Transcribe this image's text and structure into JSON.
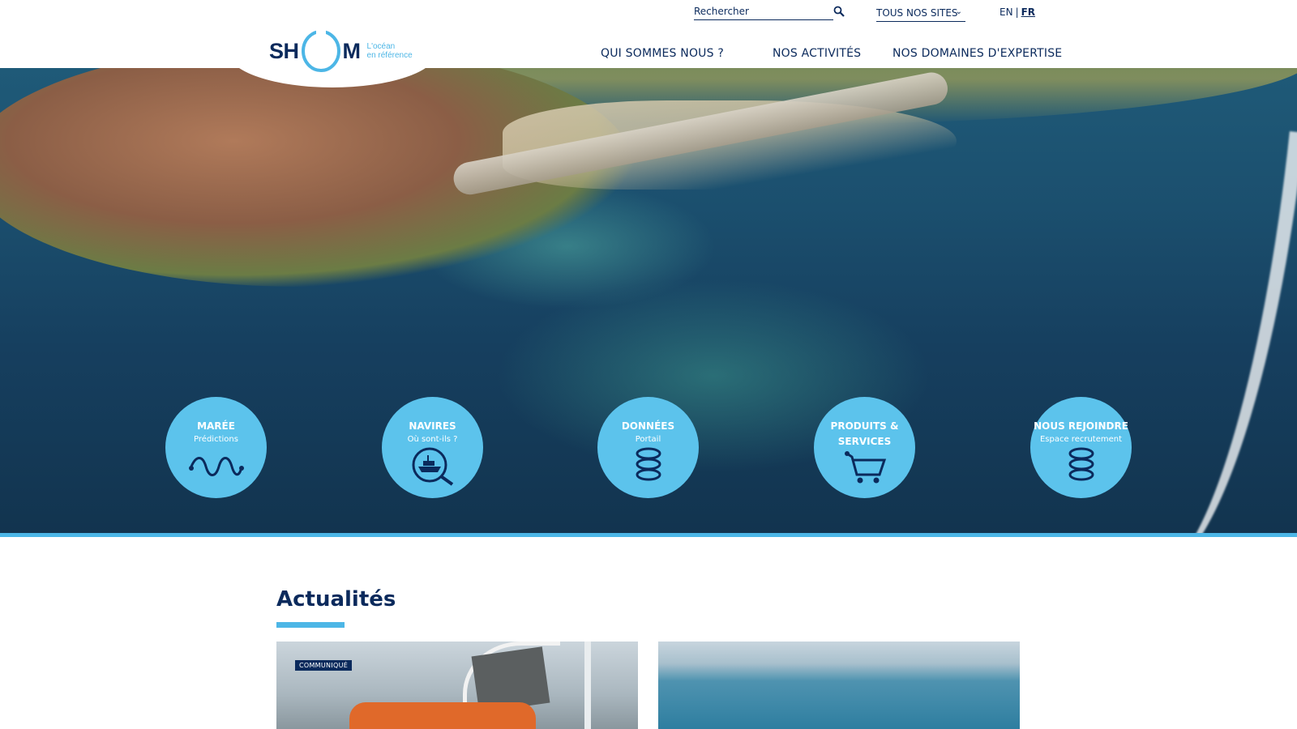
{
  "header": {
    "logo": {
      "word_left": "SH",
      "word_right": "M",
      "tagline_line1": "L'océan",
      "tagline_line2": "en référence"
    },
    "search": {
      "placeholder": "Rechercher"
    },
    "sites_dropdown": {
      "label": "TOUS NOS SITES"
    },
    "languages": {
      "en": "EN",
      "separator": "|",
      "fr": "FR",
      "active": "FR"
    },
    "nav": [
      {
        "label": "QUI SOMMES NOUS ?"
      },
      {
        "label": "NOS ACTIVITÉS"
      },
      {
        "label": "NOS DOMAINES D'EXPERTISE"
      }
    ]
  },
  "hero": {
    "quick_links": [
      {
        "title": "MARÉE",
        "subtitle": "Prédictions",
        "icon": "tide-wave-icon"
      },
      {
        "title": "NAVIRES",
        "subtitle": "Où sont-ils ?",
        "icon": "ship-search-icon"
      },
      {
        "title": "DONNÉES",
        "subtitle": "Portail",
        "icon": "data-layers-icon"
      },
      {
        "title": "PRODUITS &",
        "title_line2": "SERVICES",
        "subtitle": "",
        "icon": "cart-icon"
      },
      {
        "title": "NOUS REJOINDRE",
        "subtitle": "Espace recrutement",
        "icon": "data-layers-icon"
      }
    ]
  },
  "news": {
    "title": "Actualités",
    "cards": [
      {
        "badge": "COMMUNIQUÉ"
      },
      {
        "badge": ""
      }
    ]
  },
  "colors": {
    "navy": "#0b2a5c",
    "accent": "#4cb6e6",
    "circle": "#5cc3ec"
  }
}
